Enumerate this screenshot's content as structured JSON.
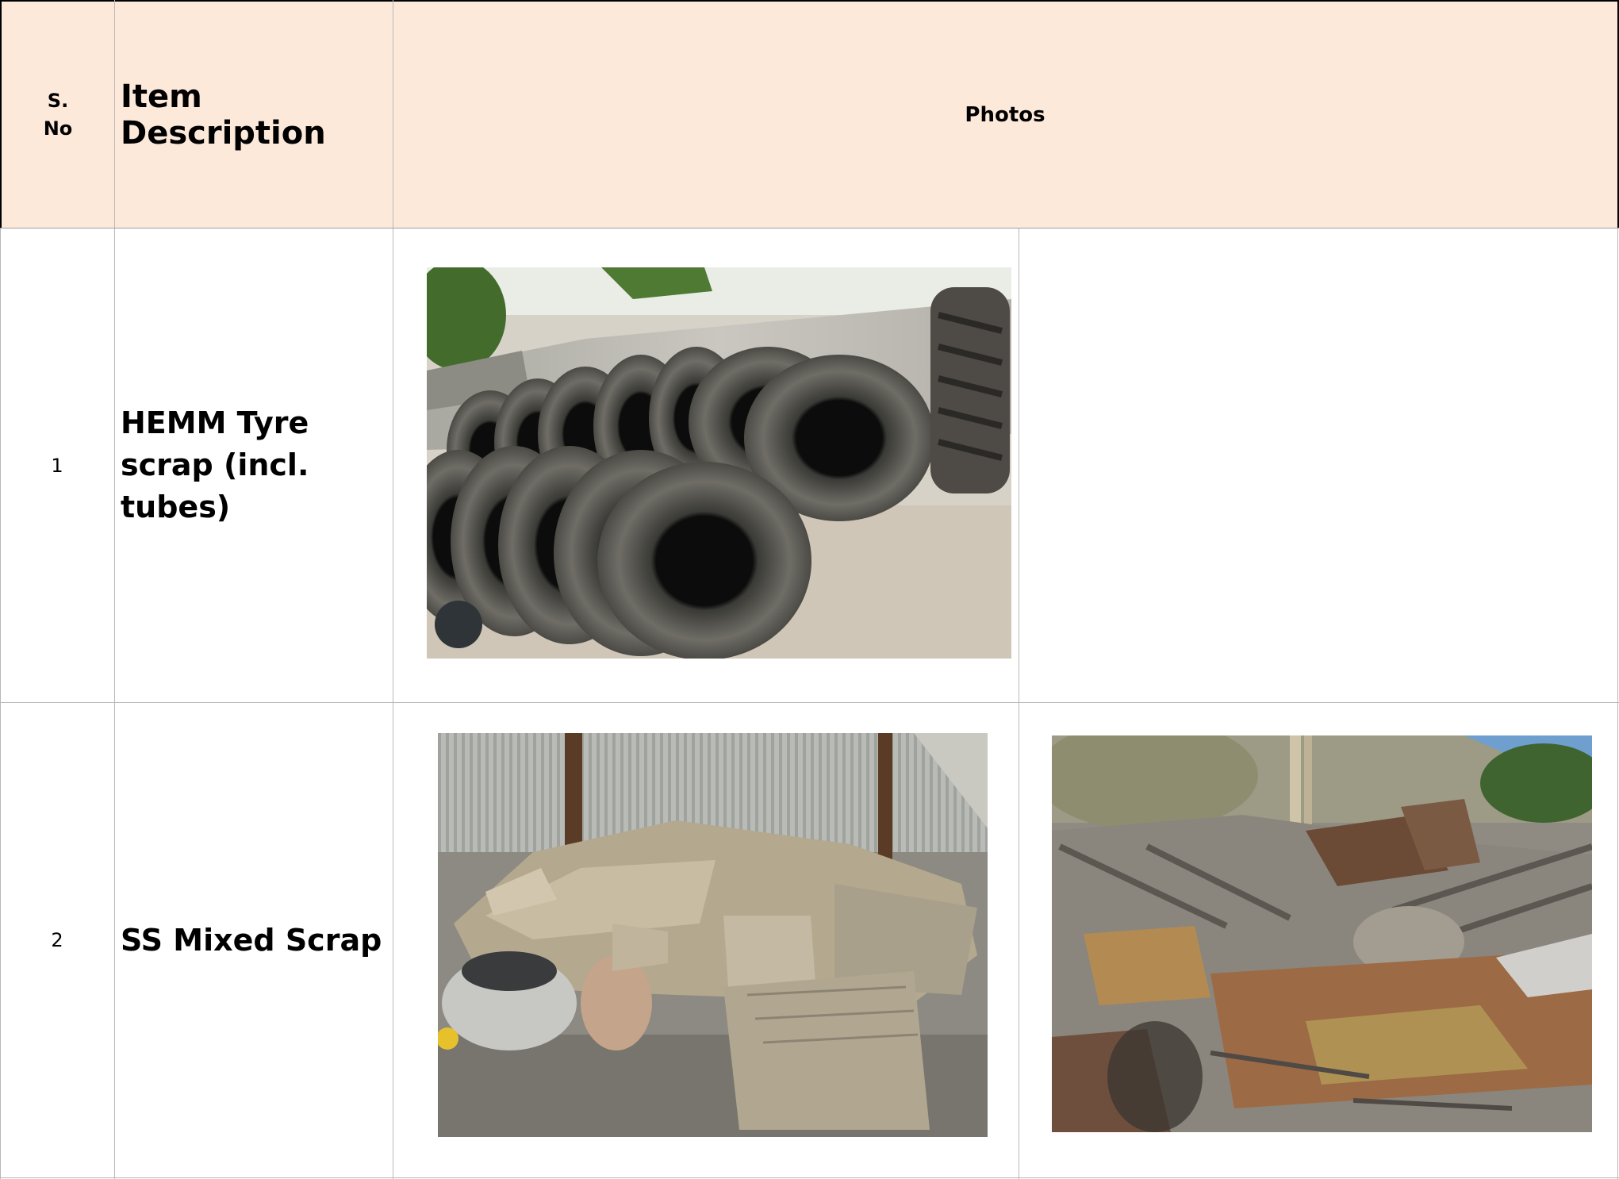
{
  "table": {
    "headers": {
      "sno": "S. No",
      "description": "Item Description",
      "photos": "Photos"
    },
    "rows": [
      {
        "sno": "1",
        "description": "HEMM Tyre scrap (incl. tubes)",
        "photos": [
          "tyre-scrap-photo"
        ]
      },
      {
        "sno": "2",
        "description": "SS Mixed Scrap",
        "photos": [
          "ss-scrap-shed-photo",
          "ss-scrap-yard-photo"
        ]
      }
    ]
  },
  "colors": {
    "header_bg": "#fde9da",
    "grid_line": "#b8b8b8"
  }
}
